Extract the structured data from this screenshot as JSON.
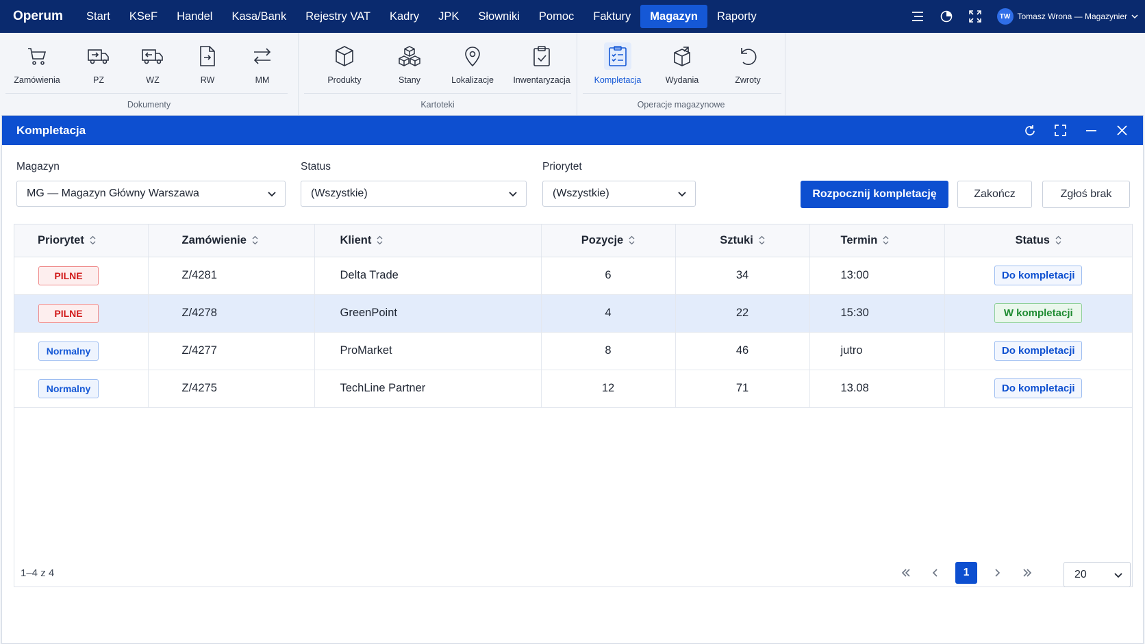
{
  "app": {
    "brand": "Operum",
    "menu": [
      "Start",
      "KSeF",
      "Handel",
      "Kasa/Bank",
      "Rejestry VAT",
      "Kadry",
      "JPK",
      "Słowniki",
      "Pomoc",
      "Faktury",
      "Magazyn",
      "Raporty"
    ],
    "active_menu": "Magazyn",
    "user": {
      "initials": "TW",
      "name": "Tomasz Wrona — Magazynier"
    }
  },
  "ribbon": {
    "groups": [
      {
        "title": "Dokumenty",
        "items": [
          "Zamówienia",
          "PZ",
          "WZ",
          "RW",
          "MM"
        ]
      },
      {
        "title": "Kartoteki",
        "items": [
          "Produkty",
          "Stany",
          "Lokalizacje",
          "Inwentaryzacja"
        ]
      },
      {
        "title": "Operacje magazynowe",
        "items": [
          "Kompletacja",
          "Wydania",
          "Zwroty"
        ]
      }
    ],
    "active_item": "Kompletacja"
  },
  "window": {
    "title": "Kompletacja",
    "filters": {
      "warehouse_label": "Magazyn",
      "warehouse_value": "MG — Magazyn Główny Warszawa",
      "status_label": "Status",
      "status_value": "(Wszystkie)",
      "priority_label": "Priorytet",
      "priority_value": "(Wszystkie)"
    },
    "buttons": {
      "start": "Rozpocznij kompletację",
      "finish": "Zakończ",
      "report": "Zgłoś brak"
    },
    "table": {
      "columns": [
        "Priorytet",
        "Zamówienie",
        "Klient",
        "Pozycje",
        "Sztuki",
        "Termin",
        "Status"
      ],
      "rows": [
        {
          "priority": "PILNE",
          "order": "Z/4281",
          "client": "Delta Trade",
          "positions": "6",
          "pieces": "34",
          "deadline": "13:00",
          "status": "Do kompletacji"
        },
        {
          "priority": "PILNE",
          "order": "Z/4278",
          "client": "GreenPoint",
          "positions": "4",
          "pieces": "22",
          "deadline": "15:30",
          "status": "W kompletacji"
        },
        {
          "priority": "Normalny",
          "order": "Z/4277",
          "client": "ProMarket",
          "positions": "8",
          "pieces": "46",
          "deadline": "jutro",
          "status": "Do kompletacji"
        },
        {
          "priority": "Normalny",
          "order": "Z/4275",
          "client": "TechLine Partner",
          "positions": "12",
          "pieces": "71",
          "deadline": "13.08",
          "status": "Do kompletacji"
        }
      ]
    },
    "footer": {
      "range": "1–4 z 4",
      "current_page": "1",
      "page_size": "20"
    }
  },
  "colors": {
    "topbar": "#0a2a6e",
    "accent": "#0d4fd0",
    "urgent": "#d11b1b",
    "in_progress": "#1c8a2f"
  }
}
